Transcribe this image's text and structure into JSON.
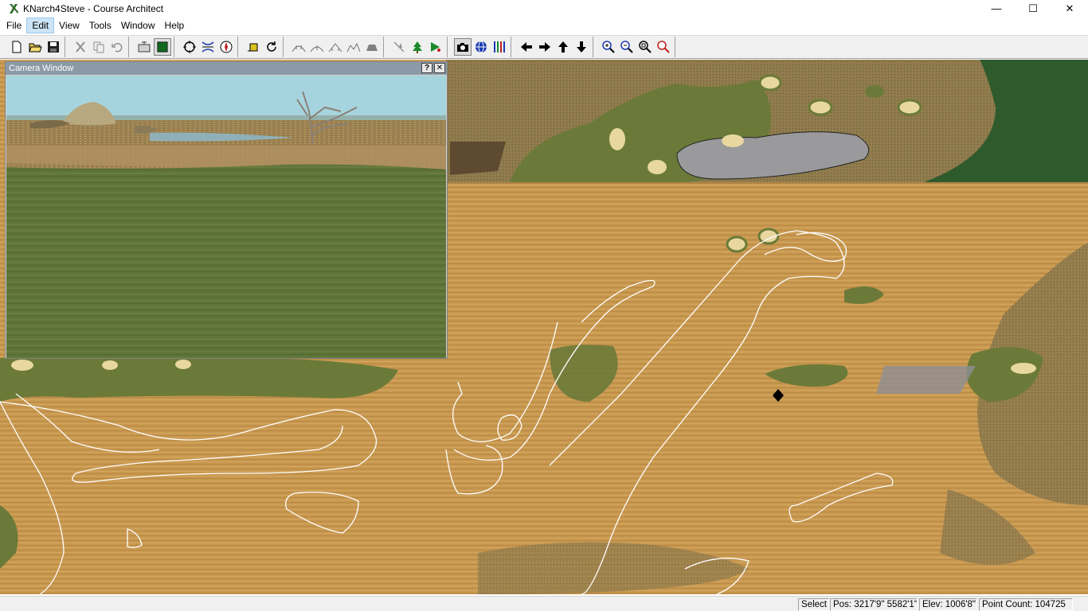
{
  "window": {
    "title": "KNarch4Steve - Course Architect",
    "minimize_glyph": "—",
    "maximize_glyph": "☐",
    "close_glyph": "✕"
  },
  "menu": {
    "items": [
      "File",
      "Edit",
      "View",
      "Tools",
      "Window",
      "Help"
    ],
    "active": "Edit"
  },
  "toolbar": {
    "groups": [
      [
        "new-file-icon",
        "open-folder-icon",
        "save-icon"
      ],
      [
        "cut-icon",
        "copy-icon",
        "undo-icon"
      ],
      [
        "grid-view-icon",
        "green-grid-icon"
      ],
      [
        "select-circle-icon",
        "split-icon",
        "compass-icon"
      ],
      [
        "yellow-square-icon",
        "rotate-icon"
      ],
      [
        "raise-terrain-icon",
        "smooth-terrain-icon",
        "lower-terrain-icon",
        "flatten-terrain-icon",
        "terrain-tool-icon"
      ],
      [
        "tree-remove-icon",
        "tree-icon",
        "object-place-icon"
      ],
      [
        "camera-icon",
        "globe-icon",
        "bars-icon"
      ],
      [
        "arrow-left-icon",
        "arrow-right-icon",
        "arrow-up-icon",
        "arrow-down-icon"
      ],
      [
        "zoom-in-icon",
        "zoom-out-icon",
        "zoom-fit-icon",
        "zoom-red-icon"
      ]
    ]
  },
  "camera_window": {
    "title": "Camera Window",
    "help_glyph": "?",
    "close_glyph": "✕"
  },
  "status": {
    "mode": "Select",
    "position": "Pos: 3217'9\"  5582'1\"",
    "elevation": "Elev: 1006'8\"",
    "point_count": "Point Count:  104725"
  },
  "colors": {
    "sand": "#c89a55",
    "rough": "#8a7a4e",
    "fairway": "#6b7a38",
    "dark_green": "#2f5a2c",
    "water": "#9a9a9c",
    "sky": "#a6d4de",
    "camera_titlebar": "#8c9aa8"
  }
}
